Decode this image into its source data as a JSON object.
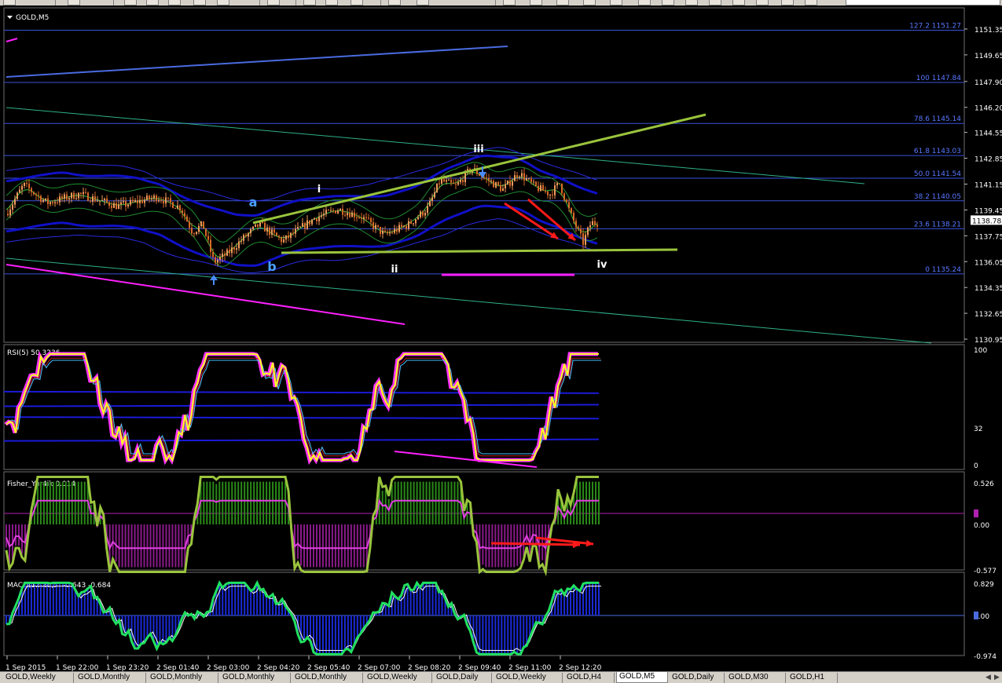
{
  "symbol_label": "GOLD,M5",
  "colors": {
    "background": "#000000",
    "grid": "#6e6e6e",
    "candle_up": "#f29a5c",
    "candle_down": "#d96a28",
    "fib": "#3a52d8",
    "trendline": "#9ac43c",
    "magenta": "#ff20ff",
    "rsi_main": "#ffff20",
    "fisher": "#9ac43c",
    "macd_hist": "#1a2ad8",
    "macd_main": "#20e060",
    "arrow": "#ff1a1a"
  },
  "price_axis": {
    "ticks": [
      "1151.35",
      "1149.65",
      "1147.90",
      "1146.20",
      "1144.55",
      "1142.85",
      "1141.15",
      "1139.45",
      "1137.75",
      "1136.05",
      "1134.35",
      "1132.65",
      "1130.95"
    ],
    "current_price": "1138.78"
  },
  "fib_levels": [
    {
      "label": "127.2 1151.27",
      "value": 1151.27
    },
    {
      "label": "100 1147.84",
      "value": 1147.84
    },
    {
      "label": "78.6 1145.14",
      "value": 1145.14
    },
    {
      "label": "61.8 1143.03",
      "value": 1143.03
    },
    {
      "label": "50.0 1141.54",
      "value": 1141.54
    },
    {
      "label": "38.2 1140.05",
      "value": 1140.05
    },
    {
      "label": "23.6 1138.21",
      "value": 1138.21
    },
    {
      "label": "0 1135.24",
      "value": 1135.24
    }
  ],
  "wave_labels": [
    "a",
    "b",
    "i",
    "ii",
    "iii",
    "iv"
  ],
  "rsi": {
    "label": "RSI(5) 50.3236",
    "ticks": [
      "100",
      "32",
      "0"
    ]
  },
  "fisher": {
    "label": "Fisher_Yur4ik 0.014",
    "ticks": [
      "0.526",
      "0.00",
      "-0.577"
    ]
  },
  "macd": {
    "label": "MACD(12,26,5) -0.643 -0.684",
    "ticks": [
      "0.829",
      "0.00",
      "-0.974"
    ]
  },
  "time_axis": [
    "1 Sep 2015",
    "1 Sep 22:00",
    "1 Sep 23:20",
    "2 Sep 01:40",
    "2 Sep 03:00",
    "2 Sep 04:20",
    "2 Sep 05:40",
    "2 Sep 07:00",
    "2 Sep 08:20",
    "2 Sep 09:40",
    "2 Sep 11:00",
    "2 Sep 12:20"
  ],
  "tabs": [
    "GOLD,Weekly",
    "GOLD,Monthly",
    "GOLD,Monthly",
    "GOLD,Monthly",
    "GOLD,Monthly",
    "GOLD,Weekly",
    "GOLD,Daily",
    "GOLD,Weekly",
    "GOLD,H4",
    "GOLD,M5",
    "GOLD,Daily",
    "GOLD,M30",
    "GOLD,H1"
  ],
  "active_tab": "GOLD,M5",
  "chart_data": {
    "type": "candlestick",
    "title": "GOLD,M5",
    "price_range": [
      1130.95,
      1151.35
    ],
    "close_path": [
      [
        "1 Sep 2015",
        1139.0
      ],
      [
        "1 Sep 22:00",
        1140.3
      ],
      [
        "1 Sep 23:20",
        1139.2
      ],
      [
        "2 Sep 01:40",
        1138.6
      ],
      [
        "2 Sep 03:00",
        1136.2
      ],
      [
        "2 Sep 04:20",
        1138.4
      ],
      [
        "2 Sep 05:40",
        1139.0
      ],
      [
        "2 Sep 07:00",
        1138.0
      ],
      [
        "2 Sep 08:20",
        1141.0
      ],
      [
        "2 Sep 09:40",
        1141.8
      ],
      [
        "2 Sep 11:00",
        1141.0
      ],
      [
        "2 Sep 12:20",
        1138.8
      ]
    ],
    "indicators": {
      "rsi_period": 5,
      "rsi_last": 50.3236,
      "fisher_last": 0.014,
      "macd_params": [
        12,
        26,
        5
      ],
      "macd_main": -0.643,
      "macd_signal": -0.684
    }
  }
}
